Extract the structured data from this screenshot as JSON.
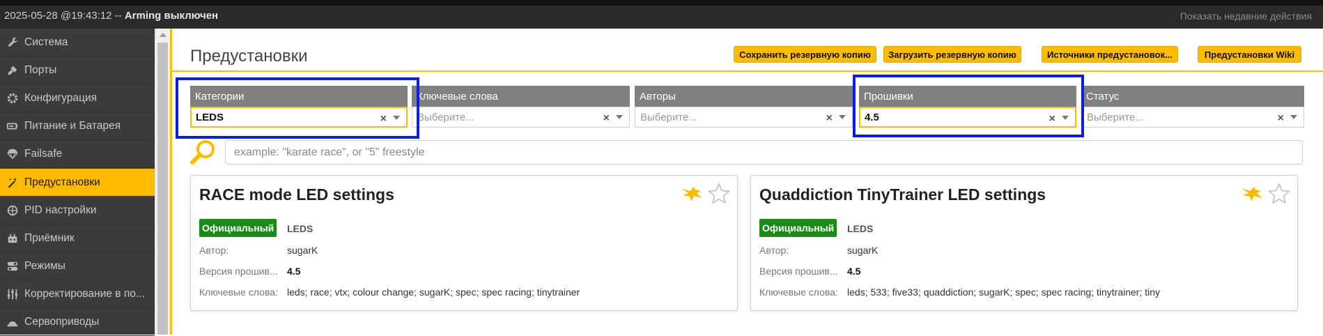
{
  "statusbar": {
    "datetime": "2025-05-28 @19:43:12",
    "separator": " -- ",
    "arming": "Arming выключен",
    "recent_actions": "Показать недавние действия"
  },
  "sidebar": {
    "items": [
      {
        "label": "Система",
        "icon": "wrench-icon"
      },
      {
        "label": "Порты",
        "icon": "plug-icon"
      },
      {
        "label": "Конфигурация",
        "icon": "gear-icon"
      },
      {
        "label": "Питание и Батарея",
        "icon": "battery-icon"
      },
      {
        "label": "Failsafe",
        "icon": "parachute-icon"
      },
      {
        "label": "Предустановки",
        "icon": "magic-wand-icon",
        "active": true
      },
      {
        "label": "PID настройки",
        "icon": "pid-icon"
      },
      {
        "label": "Приёмник",
        "icon": "receiver-icon"
      },
      {
        "label": "Режимы",
        "icon": "toggle-icon"
      },
      {
        "label": "Корректирование в по...",
        "icon": "sliders-icon"
      },
      {
        "label": "Сервоприводы",
        "icon": "servo-icon"
      }
    ]
  },
  "header": {
    "title": "Предустановки",
    "buttons": {
      "save_backup": "Сохранить резервную копию",
      "load_backup": "Загрузить резервную копию",
      "sources": "Источники предустановок...",
      "wiki": "Предустановки Wiki"
    }
  },
  "filters": {
    "categories": {
      "label": "Категории",
      "value": "LEDS"
    },
    "keywords": {
      "label": "Ключевые слова",
      "placeholder": "Выберите..."
    },
    "authors": {
      "label": "Авторы",
      "placeholder": "Выберите..."
    },
    "firmware": {
      "label": "Прошивки",
      "value": "4.5"
    },
    "status": {
      "label": "Статус",
      "placeholder": "Выберите..."
    },
    "clear_symbol": "×"
  },
  "search": {
    "placeholder": "example: \"karate race\", or \"5\" freestyle",
    "value": ""
  },
  "colors": {
    "accent": "#ffbb00",
    "sidebar_bg": "#3b3b3b",
    "official_badge": "#1a8a1a",
    "highlight": "#0a1ee6"
  },
  "cards": [
    {
      "title": "RACE mode LED settings",
      "badge": "Официальный",
      "category": "LEDS",
      "author_label": "Автор:",
      "author": "sugarK",
      "version_label": "Версия прошив...",
      "version": "4.5",
      "keywords_label": "Ключевые слова:",
      "keywords": "leds; race; vtx; colour change; sugarK; spec; spec racing; tinytrainer"
    },
    {
      "title": "Quaddiction TinyTrainer LED settings",
      "badge": "Официальный",
      "category": "LEDS",
      "author_label": "Автор:",
      "author": "sugarK",
      "version_label": "Версия прошив...",
      "version": "4.5",
      "keywords_label": "Ключевые слова:",
      "keywords": "leds; 533; five33; quaddiction; sugarK; spec; spec racing; tinytrainer; tiny"
    }
  ]
}
